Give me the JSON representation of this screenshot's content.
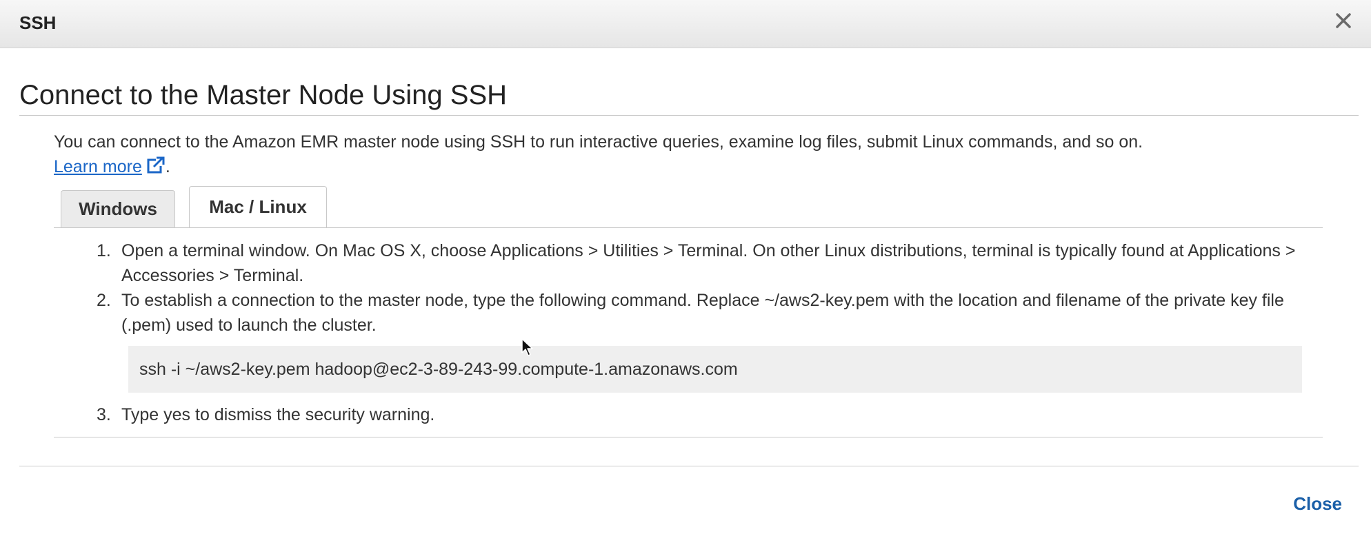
{
  "dialog": {
    "title": "SSH",
    "heading": "Connect to the Master Node Using SSH",
    "intro_text": "You can connect to the Amazon EMR master node using SSH to run interactive queries, examine log files, submit Linux commands, and so on.",
    "learn_more_label": "Learn more",
    "learn_more_suffix": "."
  },
  "tabs": [
    {
      "label": "Windows",
      "selected": false
    },
    {
      "label": "Mac / Linux",
      "selected": true
    }
  ],
  "steps": [
    {
      "number": "1.",
      "text": "Open a terminal window. On Mac OS X, choose Applications > Utilities > Terminal. On other Linux distributions, terminal is typically found at Applications > Accessories > Terminal."
    },
    {
      "number": "2.",
      "text": "To establish a connection to the master node, type the following command. Replace ~/aws2-key.pem with the location and filename of the private key file (.pem) used to launch the cluster."
    },
    {
      "number": "3.",
      "text": "Type yes to dismiss the security warning."
    }
  ],
  "command": "ssh -i ~/aws2-key.pem hadoop@ec2-3-89-243-99.compute-1.amazonaws.com",
  "footer": {
    "close_label": "Close"
  },
  "icons": {
    "close": "close-x-icon",
    "external_link": "external-link-icon",
    "cursor": "mouse-cursor-icon"
  },
  "colors": {
    "link": "#1a66c7",
    "close_button": "#1a5fa8",
    "command_bg": "#efefef"
  }
}
